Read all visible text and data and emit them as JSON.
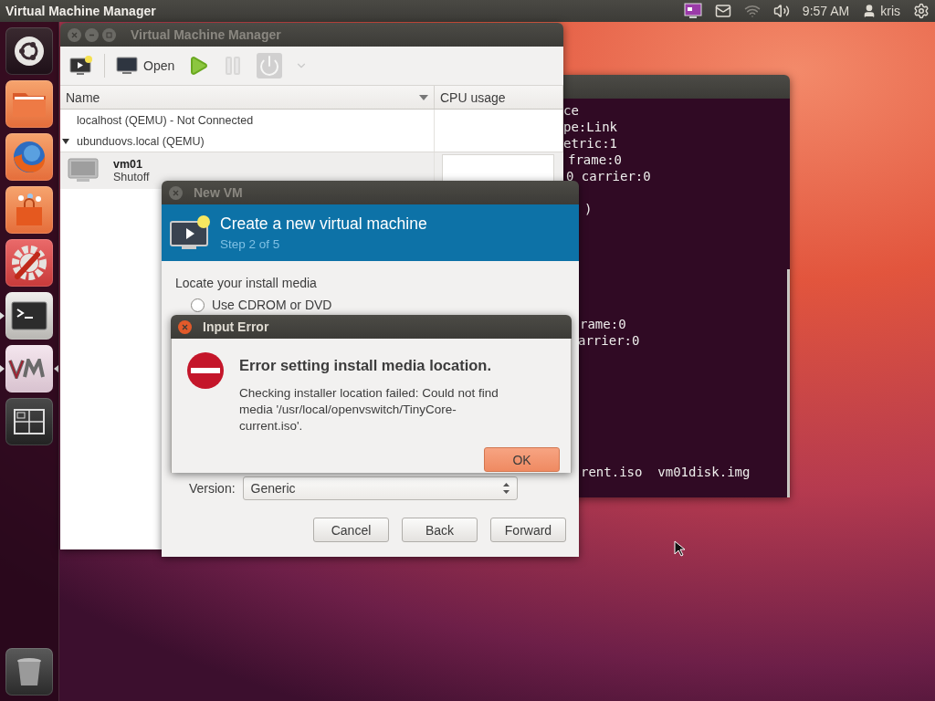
{
  "top_panel": {
    "app_title": "Virtual Machine Manager",
    "clock": "9:57 AM",
    "user": "kris"
  },
  "launcher": {
    "items": [
      {
        "kind": "dash",
        "running": false,
        "focused": false
      },
      {
        "kind": "files",
        "running": false,
        "focused": false
      },
      {
        "kind": "browser",
        "running": false,
        "focused": false
      },
      {
        "kind": "store",
        "running": false,
        "focused": false
      },
      {
        "kind": "settings",
        "running": false,
        "focused": false
      },
      {
        "kind": "terminal",
        "running": true,
        "focused": false
      },
      {
        "kind": "vm",
        "running": true,
        "focused": true
      },
      {
        "kind": "workspaces",
        "running": false,
        "focused": false
      }
    ],
    "trash": {
      "kind": "trash"
    }
  },
  "terminal": {
    "lines": [
      "ce",
      "pe:Link",
      "etric:1",
      "frame:0",
      "0 carrier:0",
      ")",
      "rame:0",
      "arrier:0",
      "rent.iso  vm01disk.img"
    ]
  },
  "vmm_window": {
    "title": "Virtual Machine Manager",
    "toolbar": [
      {
        "kind": "new",
        "disabled": false
      },
      {
        "kind": "open",
        "label": "Open",
        "disabled": false
      },
      {
        "kind": "run",
        "disabled": false
      },
      {
        "kind": "pause",
        "disabled": true
      },
      {
        "kind": "shutdown",
        "disabled": true
      },
      {
        "kind": "menu",
        "disabled": true
      }
    ],
    "columns": [
      "Name",
      "CPU usage"
    ],
    "connections": [
      {
        "label": "localhost (QEMU) - Not Connected"
      },
      {
        "label": "ubunduovs.local (QEMU)",
        "expanded": true,
        "children": [
          {
            "name": "vm01",
            "status": "Shutoff"
          }
        ]
      }
    ]
  },
  "new_vm": {
    "title": "New VM",
    "heading": "Create a new virtual machine",
    "step": "Step 2 of 5",
    "section": "Locate your install media",
    "options": [
      {
        "label": "Use CDROM or DVD",
        "selected": false
      }
    ],
    "version_label": "Version:",
    "version": "Generic",
    "buttons": [
      "Cancel",
      "Back",
      "Forward"
    ]
  },
  "error_dialog": {
    "title": "Input Error",
    "heading": "Error setting install media location.",
    "message": "Checking installer location failed: Could not find media '/usr/local/openvswitch/TinyCore-current.iso'.",
    "button": "OK"
  }
}
